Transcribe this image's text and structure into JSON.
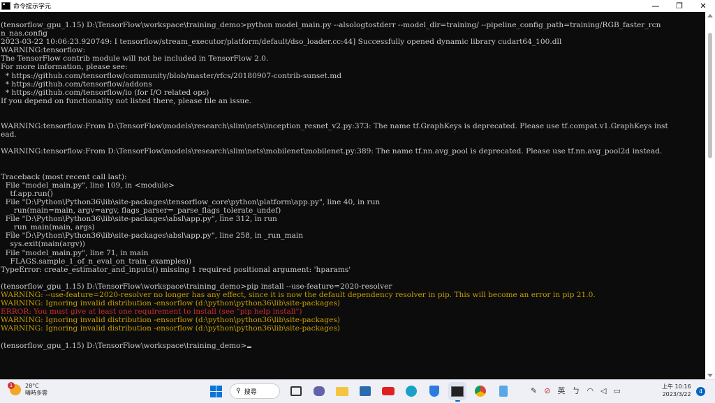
{
  "window": {
    "title": "命令提示字元",
    "buttons": {
      "minimize": "—",
      "maximize": "❐",
      "close": "✕"
    }
  },
  "console": {
    "lines": [
      {
        "text": "(tensorflow_gpu_1.15) D:\\TensorFlow\\workspace\\training_demo>python model_main.py --alsologtostderr --model_dir=training/ --pipeline_config_path=training/RGB_faster_rcn",
        "style": "normal"
      },
      {
        "text": "n_nas.config",
        "style": "normal"
      },
      {
        "text": "2023-03-22 10:06:23.920749: I tensorflow/stream_executor/platform/default/dso_loader.cc:44] Successfully opened dynamic library cudart64_100.dll",
        "style": "normal"
      },
      {
        "text": "WARNING:tensorflow:",
        "style": "normal"
      },
      {
        "text": "The TensorFlow contrib module will not be included in TensorFlow 2.0.",
        "style": "normal"
      },
      {
        "text": "For more information, please see:",
        "style": "normal"
      },
      {
        "text": "  * https://github.com/tensorflow/community/blob/master/rfcs/20180907-contrib-sunset.md",
        "style": "normal"
      },
      {
        "text": "  * https://github.com/tensorflow/addons",
        "style": "normal"
      },
      {
        "text": "  * https://github.com/tensorflow/io (for I/O related ops)",
        "style": "normal"
      },
      {
        "text": "If you depend on functionality not listed there, please file an issue.",
        "style": "normal"
      },
      {
        "text": "",
        "style": "normal"
      },
      {
        "text": "",
        "style": "normal"
      },
      {
        "text": "WARNING:tensorflow:From D:\\TensorFlow\\models\\research\\slim\\nets\\inception_resnet_v2.py:373: The name tf.GraphKeys is deprecated. Please use tf.compat.v1.GraphKeys inst",
        "style": "normal"
      },
      {
        "text": "ead.",
        "style": "normal"
      },
      {
        "text": "",
        "style": "normal"
      },
      {
        "text": "WARNING:tensorflow:From D:\\TensorFlow\\models\\research\\slim\\nets\\mobilenet\\mobilenet.py:389: The name tf.nn.avg_pool is deprecated. Please use tf.nn.avg_pool2d instead.",
        "style": "normal"
      },
      {
        "text": "",
        "style": "normal"
      },
      {
        "text": "",
        "style": "normal"
      },
      {
        "text": "Traceback (most recent call last):",
        "style": "normal"
      },
      {
        "text": "  File \"model_main.py\", line 109, in <module>",
        "style": "normal"
      },
      {
        "text": "    tf.app.run()",
        "style": "normal"
      },
      {
        "text": "  File \"D:\\Python\\Python36\\lib\\site-packages\\tensorflow_core\\python\\platform\\app.py\", line 40, in run",
        "style": "normal"
      },
      {
        "text": "    _run(main=main, argv=argv, flags_parser=_parse_flags_tolerate_undef)",
        "style": "normal"
      },
      {
        "text": "  File \"D:\\Python\\Python36\\lib\\site-packages\\absl\\app.py\", line 312, in run",
        "style": "normal"
      },
      {
        "text": "    _run_main(main, args)",
        "style": "normal"
      },
      {
        "text": "  File \"D:\\Python\\Python36\\lib\\site-packages\\absl\\app.py\", line 258, in _run_main",
        "style": "normal"
      },
      {
        "text": "    sys.exit(main(argv))",
        "style": "normal"
      },
      {
        "text": "  File \"model_main.py\", line 71, in main",
        "style": "normal"
      },
      {
        "text": "    FLAGS.sample_1_of_n_eval_on_train_examples))",
        "style": "normal"
      },
      {
        "text": "TypeError: create_estimator_and_inputs() missing 1 required positional argument: 'hparams'",
        "style": "normal"
      },
      {
        "text": "",
        "style": "normal"
      },
      {
        "text": "(tensorflow_gpu_1.15) D:\\TensorFlow\\workspace\\training_demo>pip install --use-feature=2020-resolver",
        "style": "normal"
      },
      {
        "text": "WARNING: --use-feature=2020-resolver no longer has any effect, since it is now the default dependency resolver in pip. This will become an error in pip 21.0.",
        "style": "warn"
      },
      {
        "text": "WARNING: Ignoring invalid distribution -ensorflow (d:\\python\\python36\\lib\\site-packages)",
        "style": "warn"
      },
      {
        "text": "ERROR: You must give at least one requirement to install (see \"pip help install\")",
        "style": "err"
      },
      {
        "text": "WARNING: Ignoring invalid distribution -ensorflow (d:\\python\\python36\\lib\\site-packages)",
        "style": "warn"
      },
      {
        "text": "WARNING: Ignoring invalid distribution -ensorflow (d:\\python\\python36\\lib\\site-packages)",
        "style": "warn"
      },
      {
        "text": "",
        "style": "normal"
      },
      {
        "text": "(tensorflow_gpu_1.15) D:\\TensorFlow\\workspace\\training_demo>",
        "style": "prompt"
      }
    ]
  },
  "taskbar": {
    "weather": {
      "badge": "1",
      "temp": "28°C",
      "desc": "晴時多雲"
    },
    "search_label": "搜尋",
    "input_method": "英",
    "clock_time": "上午 10:16",
    "clock_date": "2023/3/22",
    "notifications": "4"
  },
  "colors": {
    "console_bg": "#0c0c0c",
    "console_text": "#cccccc",
    "warning": "#c8a000",
    "error": "#d22a2a"
  }
}
